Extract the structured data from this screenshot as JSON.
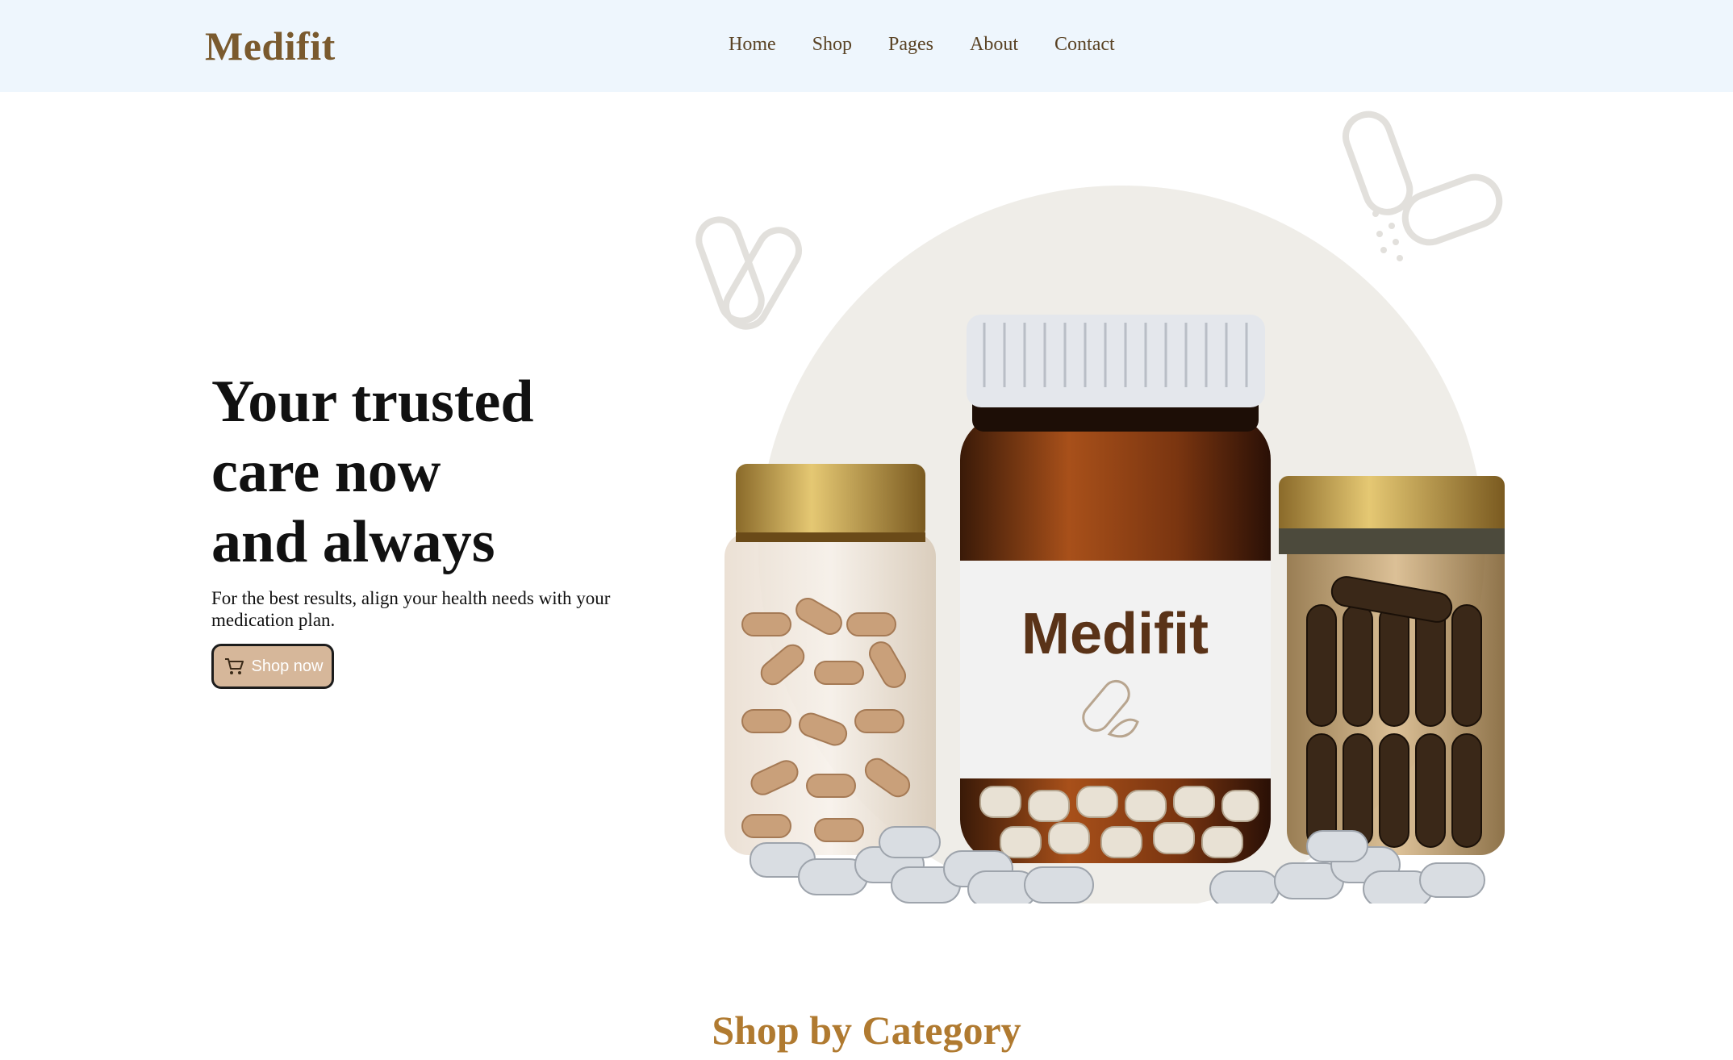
{
  "brand": {
    "name": "Medifit",
    "color": "#7a5a2e"
  },
  "nav": {
    "items": [
      {
        "label": "Home"
      },
      {
        "label": "Shop"
      },
      {
        "label": "Pages"
      },
      {
        "label": "About"
      },
      {
        "label": "Contact"
      }
    ]
  },
  "hero": {
    "title_lines": [
      "Your trusted",
      "care now",
      "and always"
    ],
    "subtitle": "For the best results, align your health needs with your medication plan.",
    "cta_label": "Shop now",
    "cta_icon": "cart-icon",
    "product_label": "Medifit"
  },
  "sections": {
    "category_title": "Shop by Category"
  },
  "colors": {
    "header_bg": "#eef6fd",
    "accent": "#b07a30",
    "button_bg": "#d6b79a"
  }
}
